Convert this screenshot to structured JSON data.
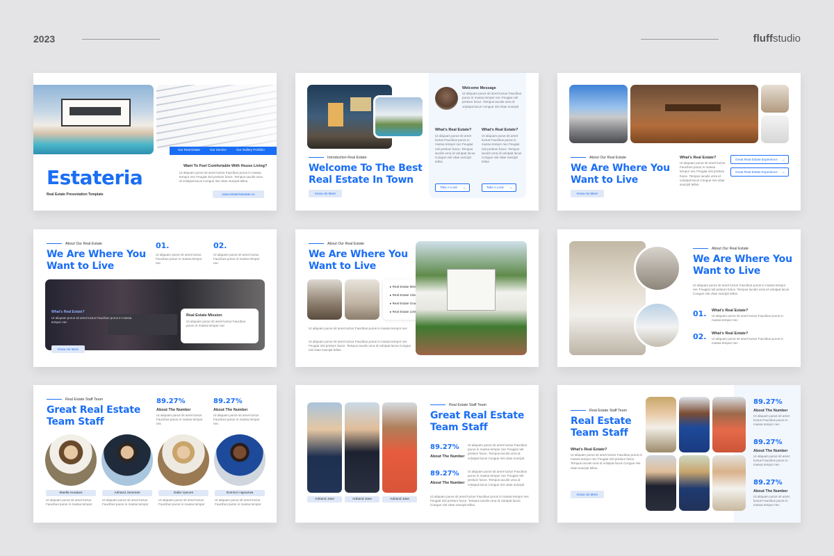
{
  "header": {
    "year": "2023",
    "brand_bold": "fluff",
    "brand_light": "studio"
  },
  "colors": {
    "accent": "#1a6ef5",
    "page_bg": "#e4e4e6",
    "light_blue": "#dfe8f8"
  },
  "lorem": "Ut aliquam purus sit amet luctus Faucibus purus in massa tempor nec Feugiat nisl pretium fusce. Tempus iaculis urna id volutpat lacus Congue nisi vitae suscipit tellus.",
  "lorem_short": "Ut aliquam purus sit amet luctus Faucibus purus in massa tempor nec",
  "s1": {
    "title": "Estateria",
    "subtitle": "Real Estate Presentation Template",
    "nav": [
      "Our Real Estate",
      "Our Service",
      "Our Gallery Portfolio"
    ],
    "question": "Want To Feel Comfortable With House Living?",
    "url": "www.estateriaestate.co"
  },
  "s2": {
    "subtitle": "Introduction Real Estate",
    "title": "Welcome To The Best Real Estate In Town",
    "button": "Know Us More",
    "welcome": "Welcome Message",
    "q1": "What's Real Estate?",
    "q2": "What's Real Estate?",
    "btn1": "Take A Look",
    "btn2": "Take A Look"
  },
  "s3": {
    "subtitle": "About Our Real Estate",
    "title": "We Are Where You Want to Live",
    "button": "Know Us More",
    "question": "What's Real Estate?",
    "exp1": "Great Real Estate Experience",
    "exp2": "Great Real Estate Experience"
  },
  "s4": {
    "subtitle": "About Our Real Estate",
    "title": "We Are Where You Want to Live",
    "n1": "01.",
    "n2": "02.",
    "overlay_q": "What's Real Estate?",
    "mission": "Real Estate Mission",
    "button": "Know Us More"
  },
  "s5": {
    "subtitle": "About Our Real Estate",
    "title": "We Are Where You Want to Live",
    "list": [
      "Real Estate Mission",
      "Real Estate Vision",
      "Real Estate Goals",
      "Real Estate Lists"
    ]
  },
  "s6": {
    "subtitle": "About Our Real Estate",
    "title": "We Are Where You Want to Live",
    "q1": "What's Real Estate?",
    "q2": "What's Real Estate?",
    "n1": "01.",
    "n2": "02."
  },
  "s7": {
    "subtitle": "Real Estate Staff Team",
    "title": "Great Real Estate Team Staff",
    "pct1": "89.27%",
    "pct2": "89.27%",
    "lbl1": "About The Number",
    "lbl2": "About The Number",
    "names": [
      "Maella Huaiaes",
      "Adriand Jusorase",
      "Daila Vyeues",
      "Dominci Hgowrwa"
    ]
  },
  "s8": {
    "subtitle": "Real Estate Staff Team",
    "title": "Great Real Estate Team Staff",
    "pct1": "89.27%",
    "pct2": "89.27%",
    "lbl1": "About The Number",
    "lbl2": "About The Number",
    "names": [
      "Adriand Jase",
      "Adriand Jase",
      "Adriand Jase"
    ]
  },
  "s9": {
    "subtitle": "Real Estate Staff Team",
    "title": "Real Estate Team Staff",
    "question": "What's Real Estate?",
    "button": "Know Us More",
    "pct1": "89.27%",
    "pct2": "89.27%",
    "pct3": "89.27%",
    "lbl1": "About The Number",
    "lbl2": "About The Number",
    "lbl3": "About The Number"
  }
}
